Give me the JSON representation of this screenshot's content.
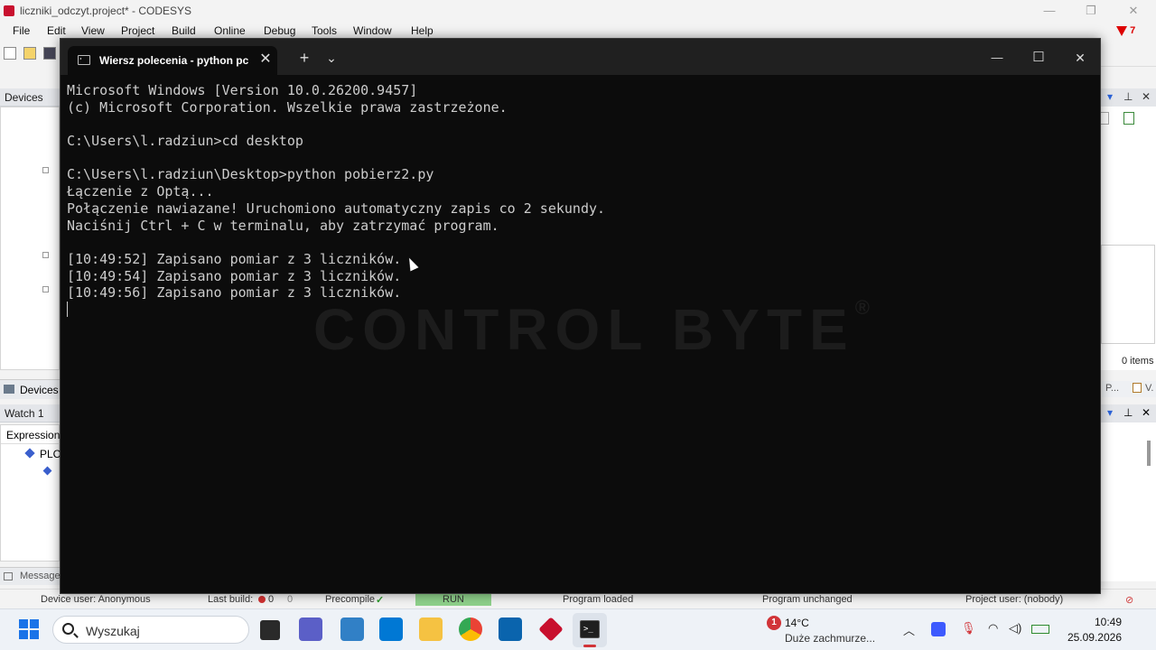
{
  "codesys": {
    "title": "liczniki_odczyt.project* - CODESYS",
    "window_controls": {
      "minimize": "—",
      "restore": "❐",
      "close": "✕"
    },
    "menu": [
      "File",
      "Edit",
      "View",
      "Project",
      "Build",
      "Online",
      "Debug",
      "Tools",
      "Window",
      "Help"
    ],
    "alert_count": "7",
    "panes": {
      "devices_title": "Devices",
      "devices_tab": "Devices",
      "watch_title": "Watch 1",
      "expression_header": "Expression",
      "tree_item": "PLC",
      "messages_tab": "Message",
      "items_count": "0 items"
    },
    "right_tabs": [
      "P...",
      "V..."
    ],
    "status_bar": {
      "device_user": "Device user: Anonymous",
      "last_build": "Last build:",
      "errors": "0",
      "warnings": "0",
      "precompile": "Precompile",
      "run": "RUN",
      "program_loaded": "Program loaded",
      "program_unchanged": "Program unchanged",
      "project_user": "Project user: (nobody)"
    }
  },
  "terminal": {
    "tab_label": "Wiersz polecenia - python pc",
    "new_tab": "+",
    "dropdown": "⌄",
    "minimize": "—",
    "maximize": "☐",
    "close": "✕",
    "tab_close": "✕",
    "watermark": "CONTROL BYTE",
    "watermark_mark": "®",
    "lines": [
      "Microsoft Windows [Version 10.0.26200.9457]",
      "(c) Microsoft Corporation. Wszelkie prawa zastrzeżone.",
      "",
      "C:\\Users\\l.radziun>cd desktop",
      "",
      "C:\\Users\\l.radziun\\Desktop>python pobierz2.py",
      "Łączenie z Optą...",
      "Połączenie nawiazane! Uruchomiono automatyczny zapis co 2 sekundy.",
      "Naciśnij Ctrl + C w terminalu, aby zatrzymać program.",
      "",
      "[10:49:52] Zapisano pomiar z 3 liczników.",
      "[10:49:54] Zapisano pomiar z 3 liczników.",
      "[10:49:56] Zapisano pomiar z 3 liczników."
    ]
  },
  "taskbar": {
    "search_placeholder": "Wyszukaj",
    "weather": {
      "badge": "1",
      "temperature": "14°C",
      "description": "Duże zachmurze..."
    },
    "clock": {
      "time": "10:49",
      "date": "25.09.2026"
    },
    "tray_icons": [
      "chevron-up-icon",
      "app-tray-icon",
      "microphone-icon",
      "wifi-icon",
      "volume-icon",
      "battery-icon"
    ],
    "colors": {
      "accent": "#1a73e8",
      "active_indicator": "#d13438"
    }
  }
}
